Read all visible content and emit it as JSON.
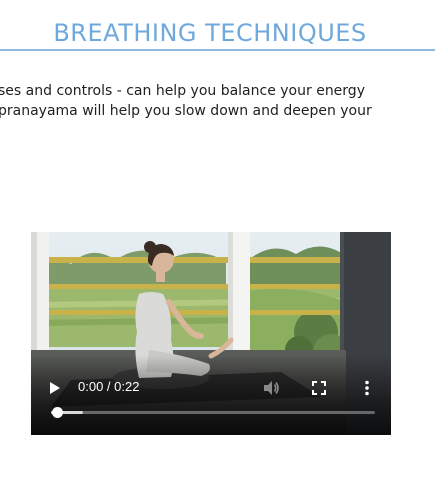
{
  "section": {
    "title": "BREATHING TECHNIQUES",
    "accent_color": "#6fa8dc"
  },
  "paragraph": {
    "line1": "ses and controls - can help you balance your energy",
    "line2": "pranayama will help you slow down and deepen your"
  },
  "video": {
    "current_time": "0:00",
    "duration": "0:22",
    "time_display": "0:00 / 0:22",
    "progress_fraction": 0.0,
    "icons": {
      "play": "play-icon",
      "volume": "volume-icon",
      "fullscreen": "fullscreen-icon",
      "more": "more-vert-icon"
    }
  }
}
